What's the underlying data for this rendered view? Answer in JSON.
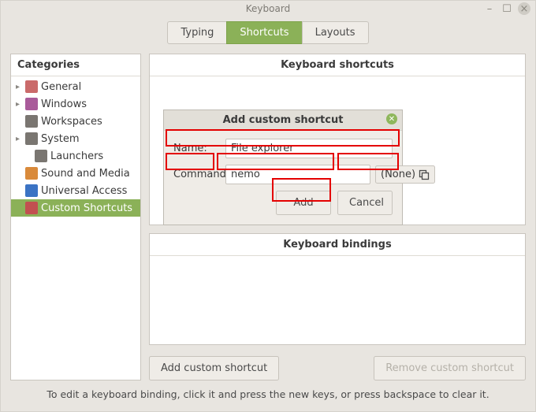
{
  "window": {
    "title": "Keyboard",
    "minimize": "–",
    "maximize": "☐",
    "close": "×"
  },
  "tabs": [
    {
      "label": "Typing",
      "active": false
    },
    {
      "label": "Shortcuts",
      "active": true
    },
    {
      "label": "Layouts",
      "active": false
    }
  ],
  "sidebar": {
    "header": "Categories",
    "items": [
      {
        "label": "General",
        "expandable": true,
        "indent": false,
        "icon": "ico-general",
        "selected": false
      },
      {
        "label": "Windows",
        "expandable": true,
        "indent": false,
        "icon": "ico-windows",
        "selected": false
      },
      {
        "label": "Workspaces",
        "expandable": false,
        "indent": false,
        "icon": "ico-workspaces",
        "selected": false
      },
      {
        "label": "System",
        "expandable": true,
        "indent": false,
        "icon": "ico-system",
        "selected": false
      },
      {
        "label": "Launchers",
        "expandable": false,
        "indent": true,
        "icon": "ico-launchers",
        "selected": false
      },
      {
        "label": "Sound and Media",
        "expandable": false,
        "indent": false,
        "icon": "ico-sound",
        "selected": false
      },
      {
        "label": "Universal Access",
        "expandable": false,
        "indent": false,
        "icon": "ico-universal",
        "selected": false
      },
      {
        "label": "Custom Shortcuts",
        "expandable": false,
        "indent": false,
        "icon": "ico-custom",
        "selected": true
      }
    ]
  },
  "panels": {
    "shortcuts_header": "Keyboard shortcuts",
    "bindings_header": "Keyboard bindings"
  },
  "buttons": {
    "add_custom": "Add custom shortcut",
    "remove_custom": "Remove custom shortcut"
  },
  "hint": "To edit a keyboard binding, click it and press the new keys, or press backspace to clear it.",
  "dialog": {
    "title": "Add custom shortcut",
    "name_label": "Name:",
    "name_value": "File explorer",
    "command_label": "Command:",
    "command_value": "nemo",
    "none_label": "(None)",
    "add": "Add",
    "cancel": "Cancel"
  }
}
